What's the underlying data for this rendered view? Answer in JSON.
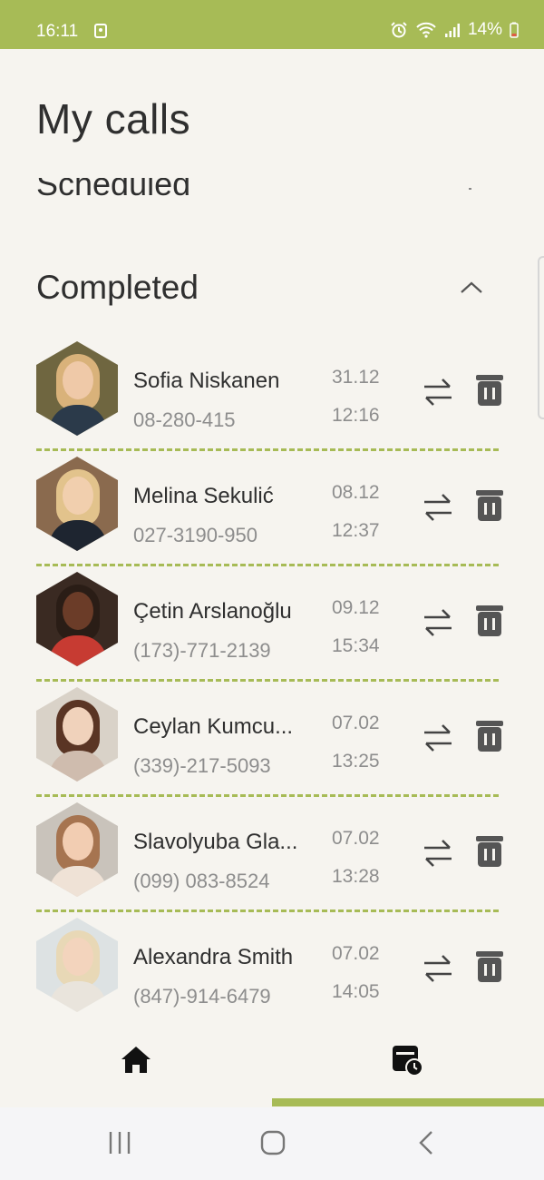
{
  "status_bar": {
    "time": "16:11",
    "battery": "14%",
    "colors": {
      "background": "#a7bb56"
    }
  },
  "title": "My calls",
  "sections": {
    "scheduled_label": "Scheduled",
    "completed_label": "Completed"
  },
  "accent_color": "#a7bb56",
  "calls": [
    {
      "name": "Sofia Niskanen",
      "phone": "08-280-415",
      "date": "31.12",
      "time": "12:16"
    },
    {
      "name": "Melina Sekulić",
      "phone": "027-3190-950",
      "date": "08.12",
      "time": "12:37"
    },
    {
      "name": "Çetin Arslanoğlu",
      "phone": "(173)-771-2139",
      "date": "09.12",
      "time": "15:34"
    },
    {
      "name": "Ceylan Kumcu...",
      "phone": "(339)-217-5093",
      "date": "07.02",
      "time": "13:25"
    },
    {
      "name": "Slavolyuba Gla...",
      "phone": "(099) 083-8524",
      "date": "07.02",
      "time": "13:28"
    },
    {
      "name": "Alexandra Smith",
      "phone": "(847)-914-6479",
      "date": "07.02",
      "time": "14:05"
    }
  ],
  "icons": {
    "row_actions": [
      "swap-arrows-icon",
      "trash-icon"
    ],
    "bottom_nav": [
      "home-icon",
      "scheduled-calendar-icon"
    ],
    "system_nav": [
      "recent-apps-icon",
      "home-circle-icon",
      "back-icon"
    ]
  }
}
